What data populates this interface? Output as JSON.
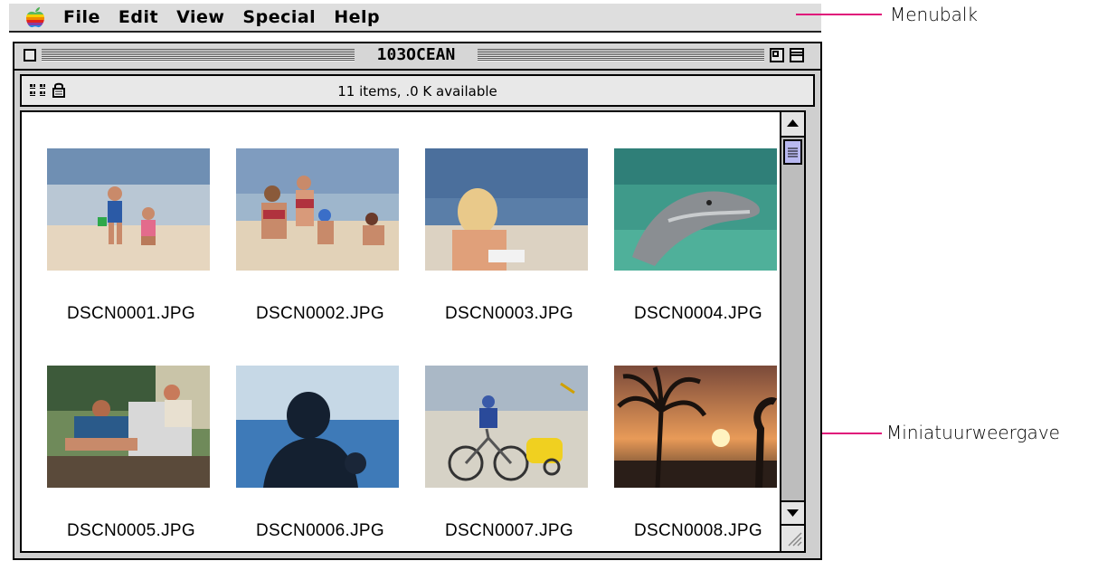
{
  "menubar": {
    "items": [
      "File",
      "Edit",
      "View",
      "Special",
      "Help"
    ]
  },
  "window": {
    "title": "103OCEAN",
    "status": "11 items, .0 K available"
  },
  "files": [
    {
      "name": "DSCN0001.JPG",
      "scene": "two children playing on a beach"
    },
    {
      "name": "DSCN0002.JPG",
      "scene": "family in swimsuits on beach"
    },
    {
      "name": "DSCN0003.JPG",
      "scene": "girl sitting by the sea"
    },
    {
      "name": "DSCN0004.JPG",
      "scene": "dolphin in water"
    },
    {
      "name": "DSCN0005.JPG",
      "scene": "people sunbathing on chairs"
    },
    {
      "name": "DSCN0006.JPG",
      "scene": "silhouette facing the sea"
    },
    {
      "name": "DSCN0007.JPG",
      "scene": "cyclist on beach with trailer"
    },
    {
      "name": "DSCN0008.JPG",
      "scene": "palm tree at sunset"
    }
  ],
  "callouts": {
    "menubar": "Menubalk",
    "thumbnail_view": "Miniatuurweergave"
  },
  "colors": {
    "callout": "#e0147a",
    "scroll_thumb": "#b8b8f0"
  }
}
